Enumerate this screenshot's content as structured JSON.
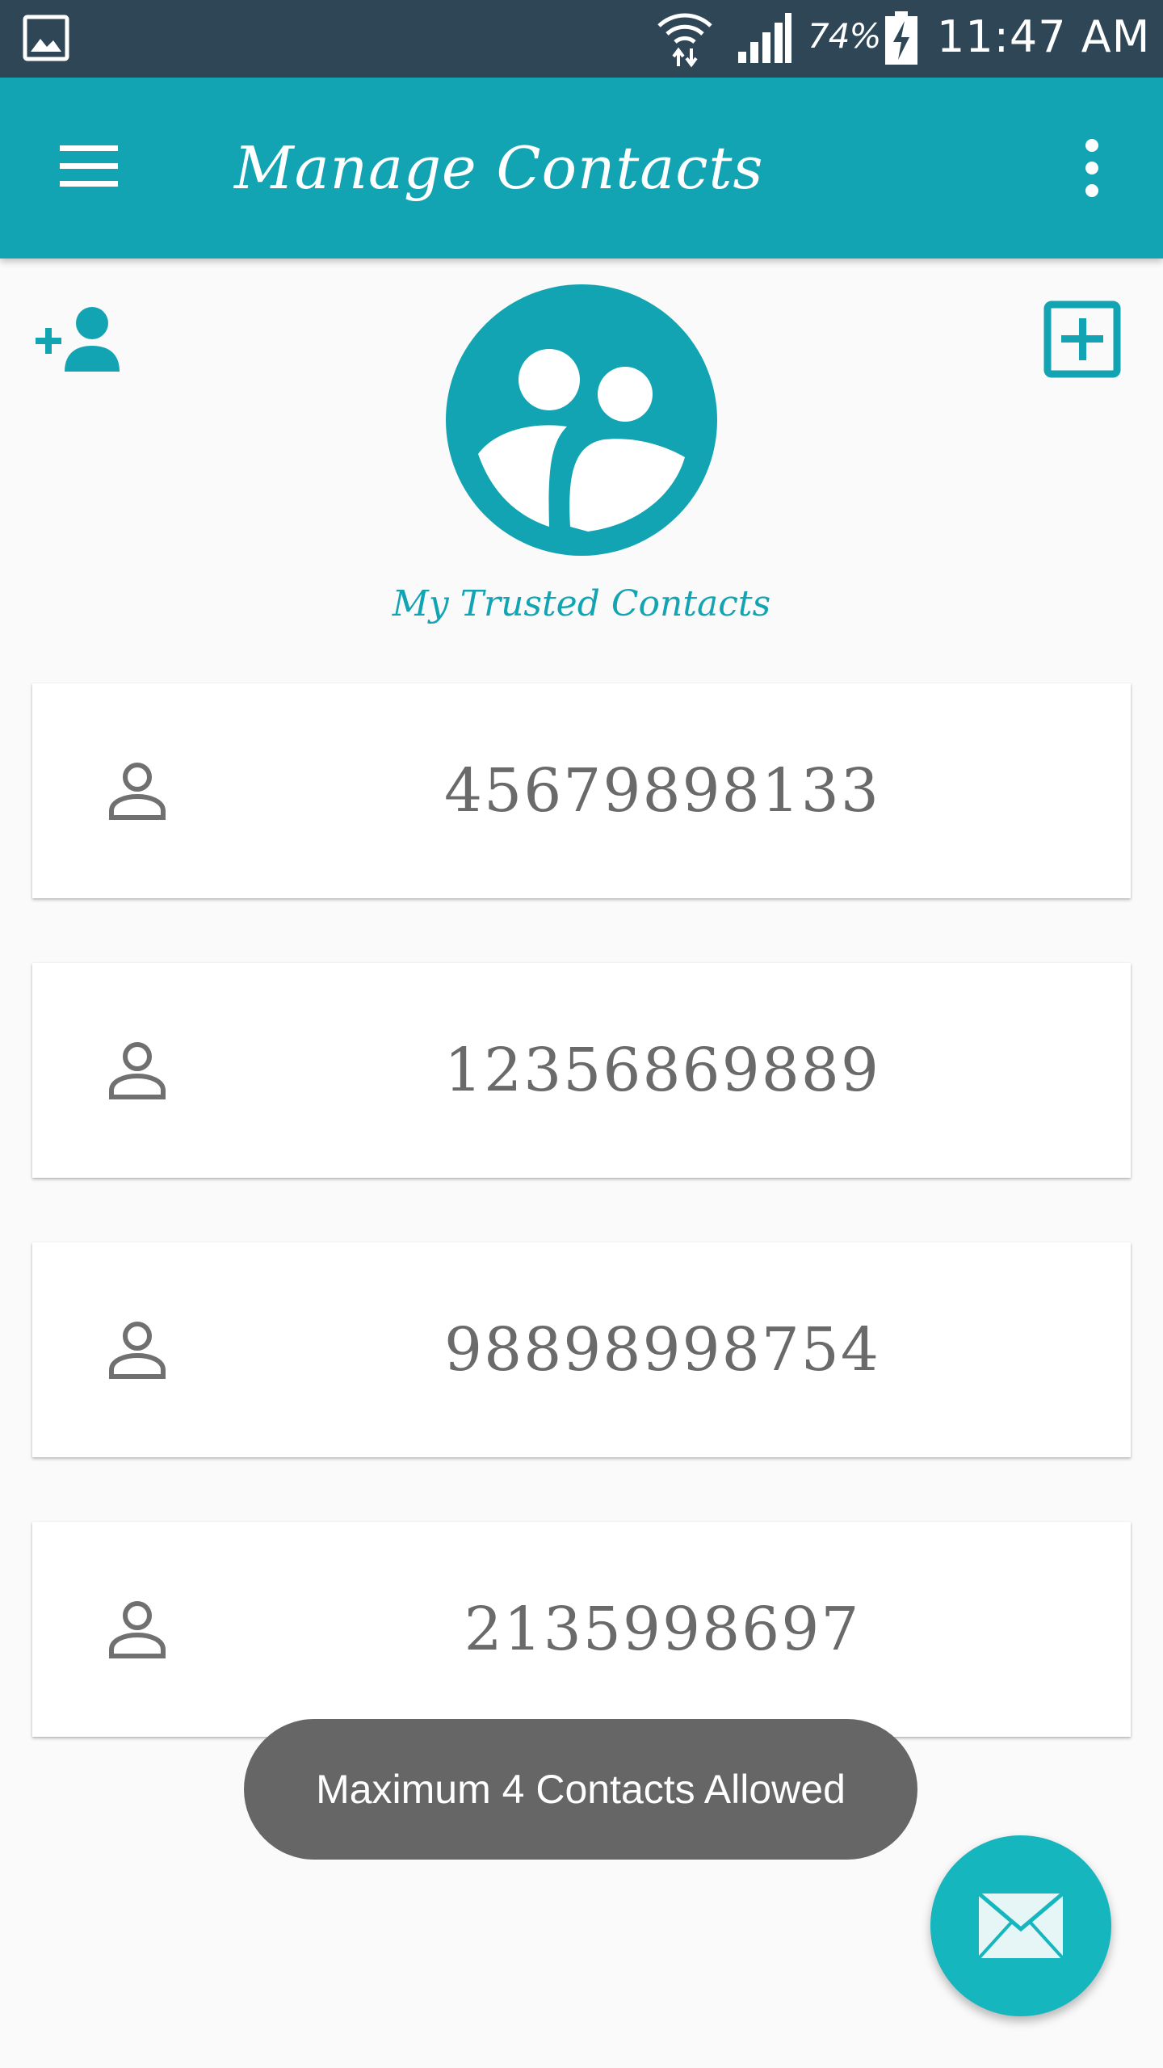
{
  "status_bar": {
    "battery_percent": "74%",
    "time": "11:47 AM",
    "icons": [
      "gallery-icon",
      "wifi-icon",
      "signal-icon",
      "battery-charging-icon"
    ]
  },
  "app_bar": {
    "title": "Manage Contacts",
    "icons": [
      "menu-icon",
      "more-vert-icon"
    ]
  },
  "header": {
    "caption": "My Trusted Contacts",
    "icons": [
      "add-person-icon",
      "group-avatar-icon",
      "add-box-icon"
    ]
  },
  "contacts": [
    {
      "number": "45679898133",
      "icon": "person-icon"
    },
    {
      "number": "12356869889",
      "icon": "person-icon"
    },
    {
      "number": "98898998754",
      "icon": "person-icon"
    },
    {
      "number": "2135998697",
      "icon": "person-icon"
    }
  ],
  "toast": {
    "message": "Maximum 4 Contacts Allowed"
  },
  "fab": {
    "icon": "mail-icon"
  },
  "colors": {
    "status_bar": "#2f4657",
    "primary": "#12a4b2",
    "fab": "#15b6bd",
    "toast": "#666666",
    "background": "#fafafa",
    "contact_text": "#6a6a6a"
  }
}
